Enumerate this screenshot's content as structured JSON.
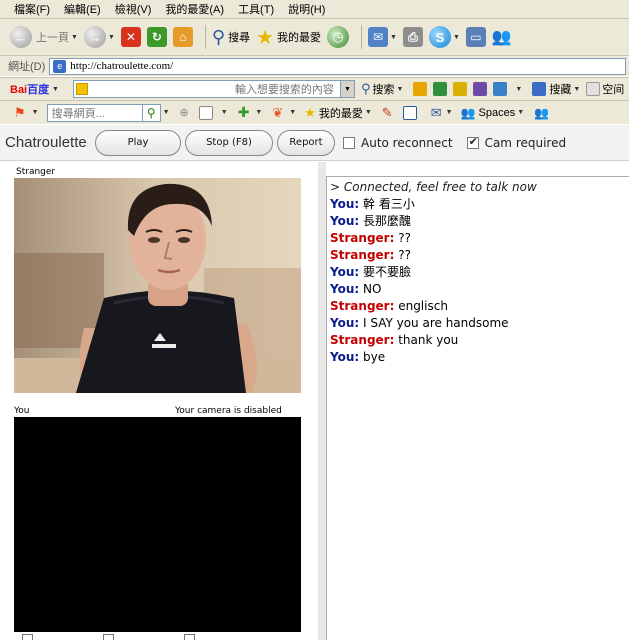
{
  "menu": [
    "檔案(F)",
    "編輯(E)",
    "檢視(V)",
    "我的最愛(A)",
    "工具(T)",
    "說明(H)"
  ],
  "toolbar": {
    "back_label": "上一頁",
    "search_label": "搜尋",
    "favorites_label": "我的最愛"
  },
  "address": {
    "label": "網址(D)",
    "url": "http://chatroulette.com/"
  },
  "baidu": {
    "logo_a": "Bai",
    "logo_b": "百度",
    "placeholder": "輸入想要搜索的內容",
    "search_label": "搜索",
    "search2_label": "搜藏",
    "more_label": "空间"
  },
  "live": {
    "search_placeholder": "搜尋網頁...",
    "favorites_label": "我的最愛",
    "spaces_label": "Spaces"
  },
  "chatroulette": {
    "title": "Chatroulette",
    "play_label": "Play",
    "stop_label": "Stop (F8)",
    "report_label": "Report",
    "auto_reconnect_label": "Auto reconnect",
    "cam_required_label": "Cam required",
    "stranger_label": "Stranger",
    "you_label": "You",
    "camera_disabled": "Your camera is disabled"
  },
  "chat": {
    "system": "> Connected, feel free to talk now",
    "messages": [
      {
        "who": "You:",
        "text": " 幹  看三小"
      },
      {
        "who": "You:",
        "text": " 長那麼醜"
      },
      {
        "who": "Stranger:",
        "text": " ??"
      },
      {
        "who": "Stranger:",
        "text": " ??"
      },
      {
        "who": "You:",
        "text": " 要不要臉"
      },
      {
        "who": "You:",
        "text": " NO"
      },
      {
        "who": "Stranger:",
        "text": " englisch"
      },
      {
        "who": "You:",
        "text": " I SAY you are handsome"
      },
      {
        "who": "Stranger:",
        "text": " thank you"
      },
      {
        "who": "You:",
        "text": " bye"
      }
    ]
  },
  "colors": {
    "chrome": "#ece9d8",
    "you": "#0a1d8c",
    "stranger": "#c40000"
  }
}
